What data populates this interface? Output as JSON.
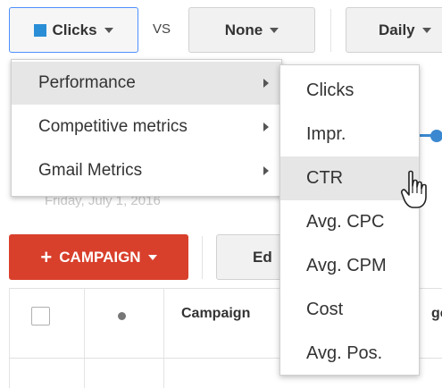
{
  "toolbar": {
    "metric1_label": "Clicks",
    "vs_label": "VS",
    "metric2_label": "None",
    "range_label": "Daily",
    "metric1_color": "#2a8ed6"
  },
  "chart": {
    "date_label": "Friday, July 1, 2016",
    "line_color": "#3a88d0"
  },
  "actions": {
    "campaign_label": "CAMPAIGN",
    "campaign_plus": "+",
    "edit_label": "Ed",
    "campaign_color": "#d8402c"
  },
  "table": {
    "columns": [
      "Campaign",
      "ge"
    ]
  },
  "menu": {
    "items": [
      {
        "label": "Performance",
        "highlighted": true
      },
      {
        "label": "Competitive metrics",
        "highlighted": false
      },
      {
        "label": "Gmail Metrics",
        "highlighted": false
      }
    ]
  },
  "submenu": {
    "items": [
      {
        "label": "Clicks",
        "highlighted": false
      },
      {
        "label": "Impr.",
        "highlighted": false
      },
      {
        "label": "CTR",
        "highlighted": true
      },
      {
        "label": "Avg. CPC",
        "highlighted": false
      },
      {
        "label": "Avg. CPM",
        "highlighted": false
      },
      {
        "label": "Cost",
        "highlighted": false
      },
      {
        "label": "Avg. Pos.",
        "highlighted": false
      }
    ]
  },
  "cursor": {
    "icon": "hand-pointer-icon"
  }
}
